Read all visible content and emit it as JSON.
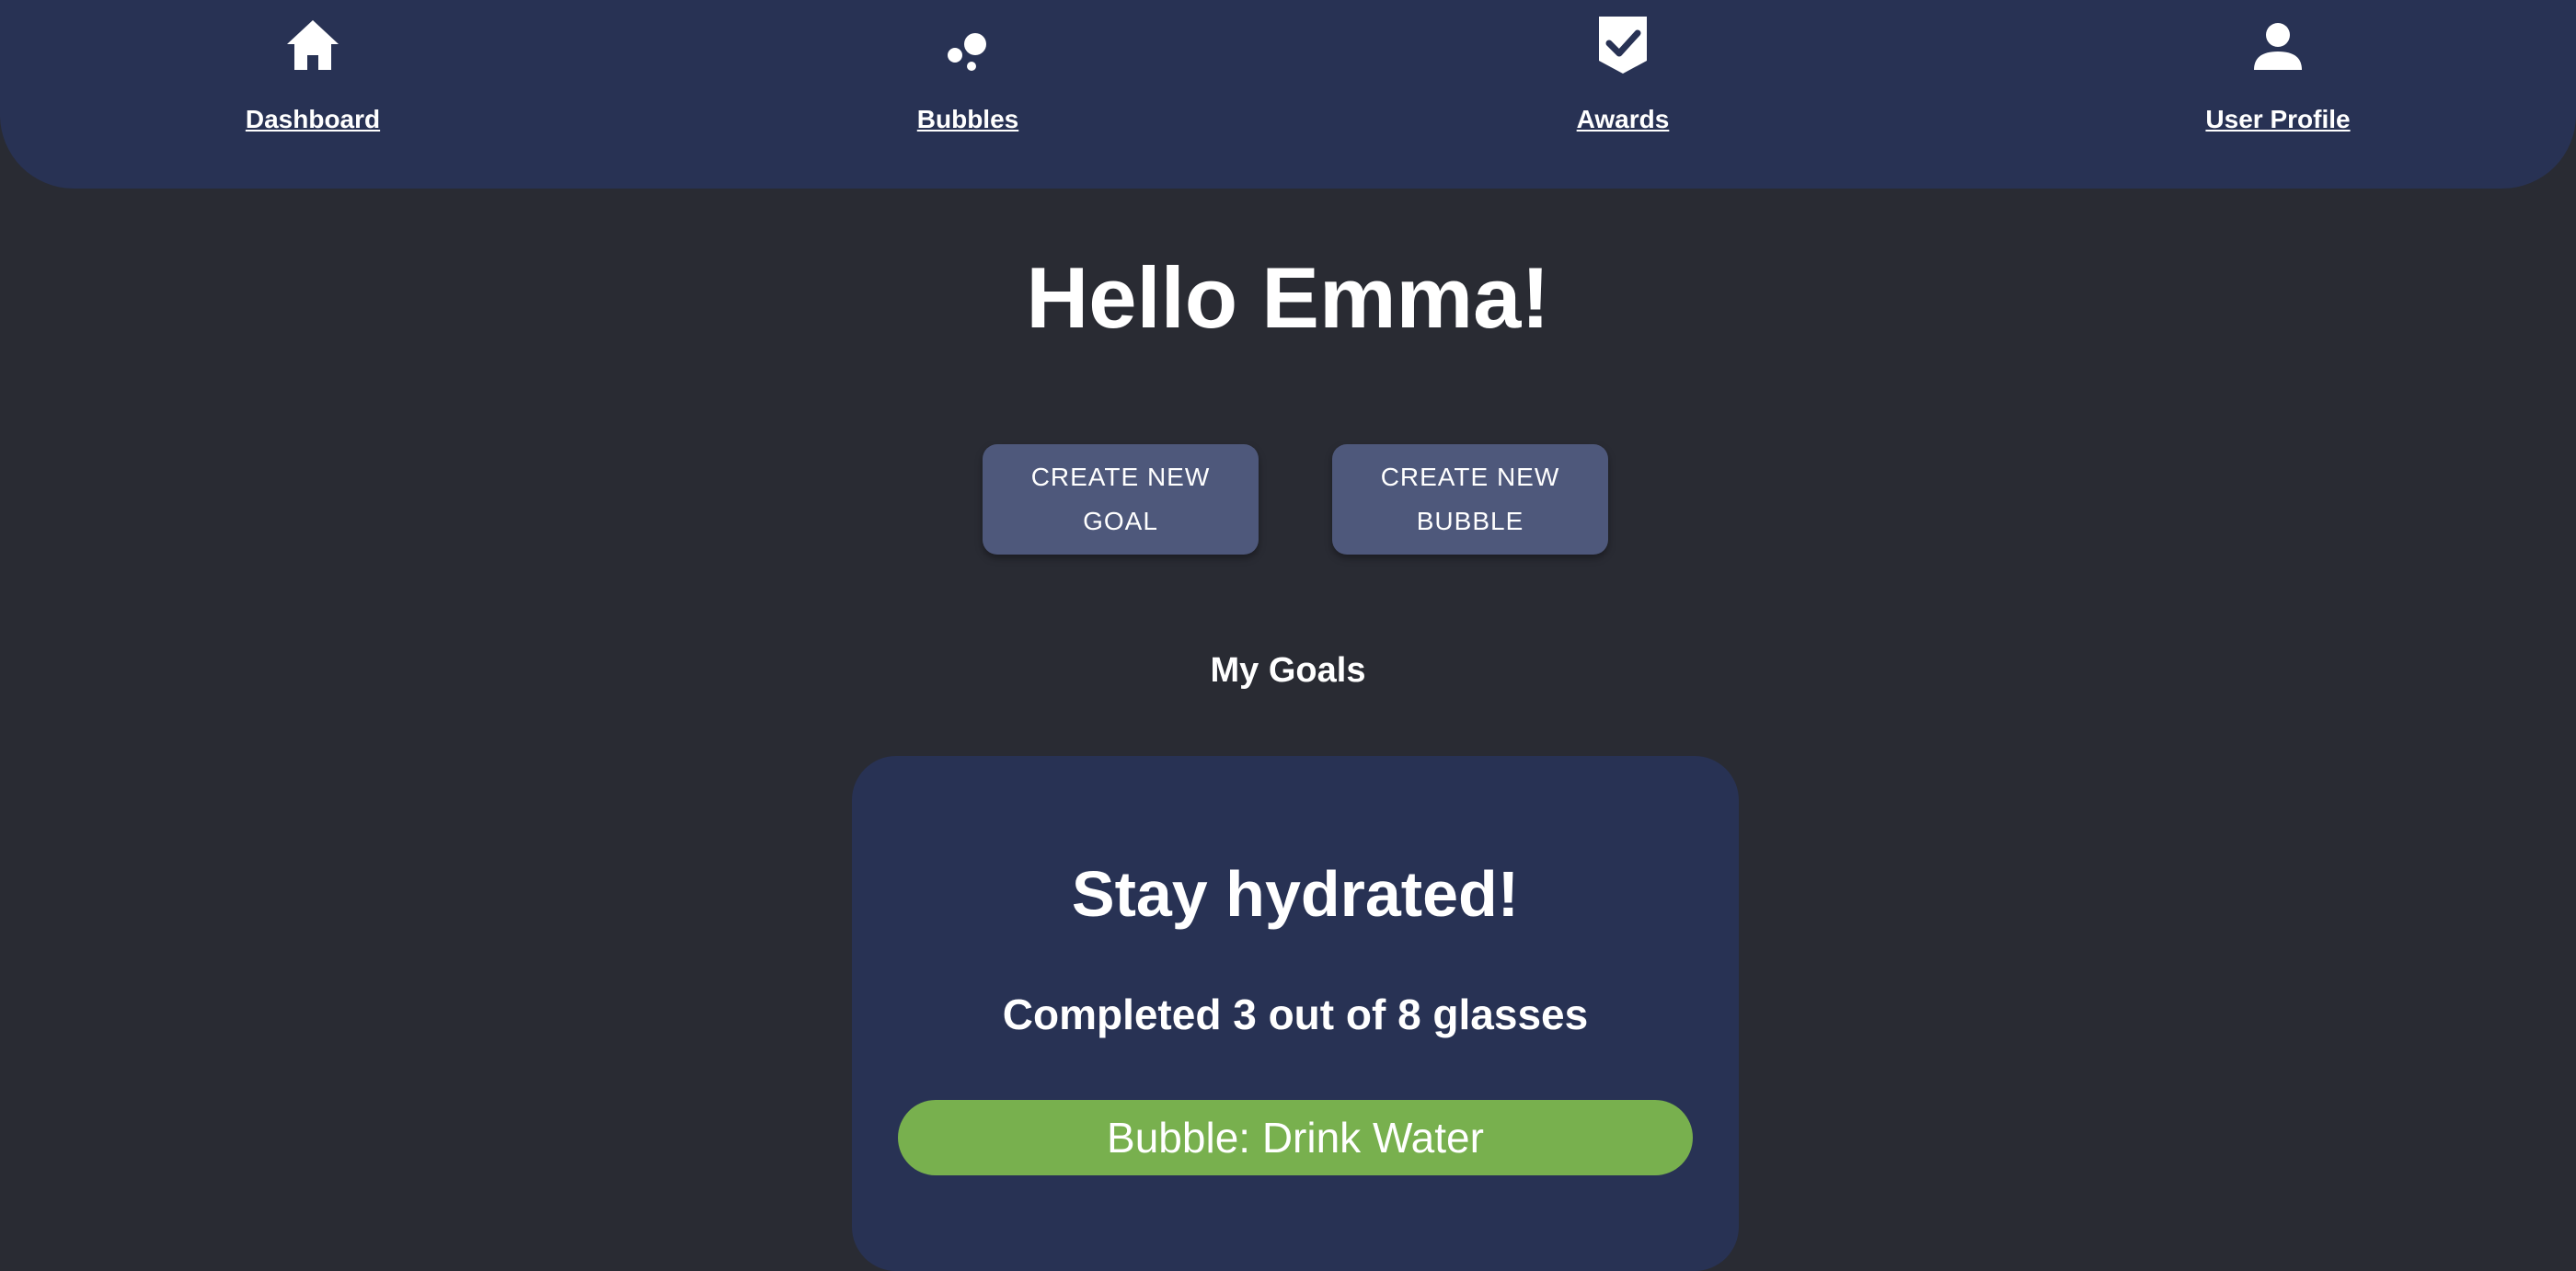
{
  "nav": {
    "items": [
      {
        "label": "Dashboard",
        "icon": "home-icon"
      },
      {
        "label": "Bubbles",
        "icon": "bubbles-icon"
      },
      {
        "label": "Awards",
        "icon": "award-check-icon"
      },
      {
        "label": "User Profile",
        "icon": "user-icon"
      }
    ]
  },
  "greeting": "Hello Emma!",
  "actions": {
    "create_goal": "CREATE NEW GOAL",
    "create_bubble": "CREATE NEW BUBBLE"
  },
  "goals_section": {
    "title": "My Goals",
    "goals": [
      {
        "title": "Stay hydrated!",
        "progress_text": "Completed 3 out of 8 glasses",
        "completed": 3,
        "total": 8,
        "bubble_label": "Bubble: Drink Water"
      }
    ]
  },
  "colors": {
    "background": "#292b33",
    "nav_background": "#283254",
    "button_background": "#4e587b",
    "card_background": "#283254",
    "bubble_green": "#78b04e",
    "text": "#ffffff"
  }
}
